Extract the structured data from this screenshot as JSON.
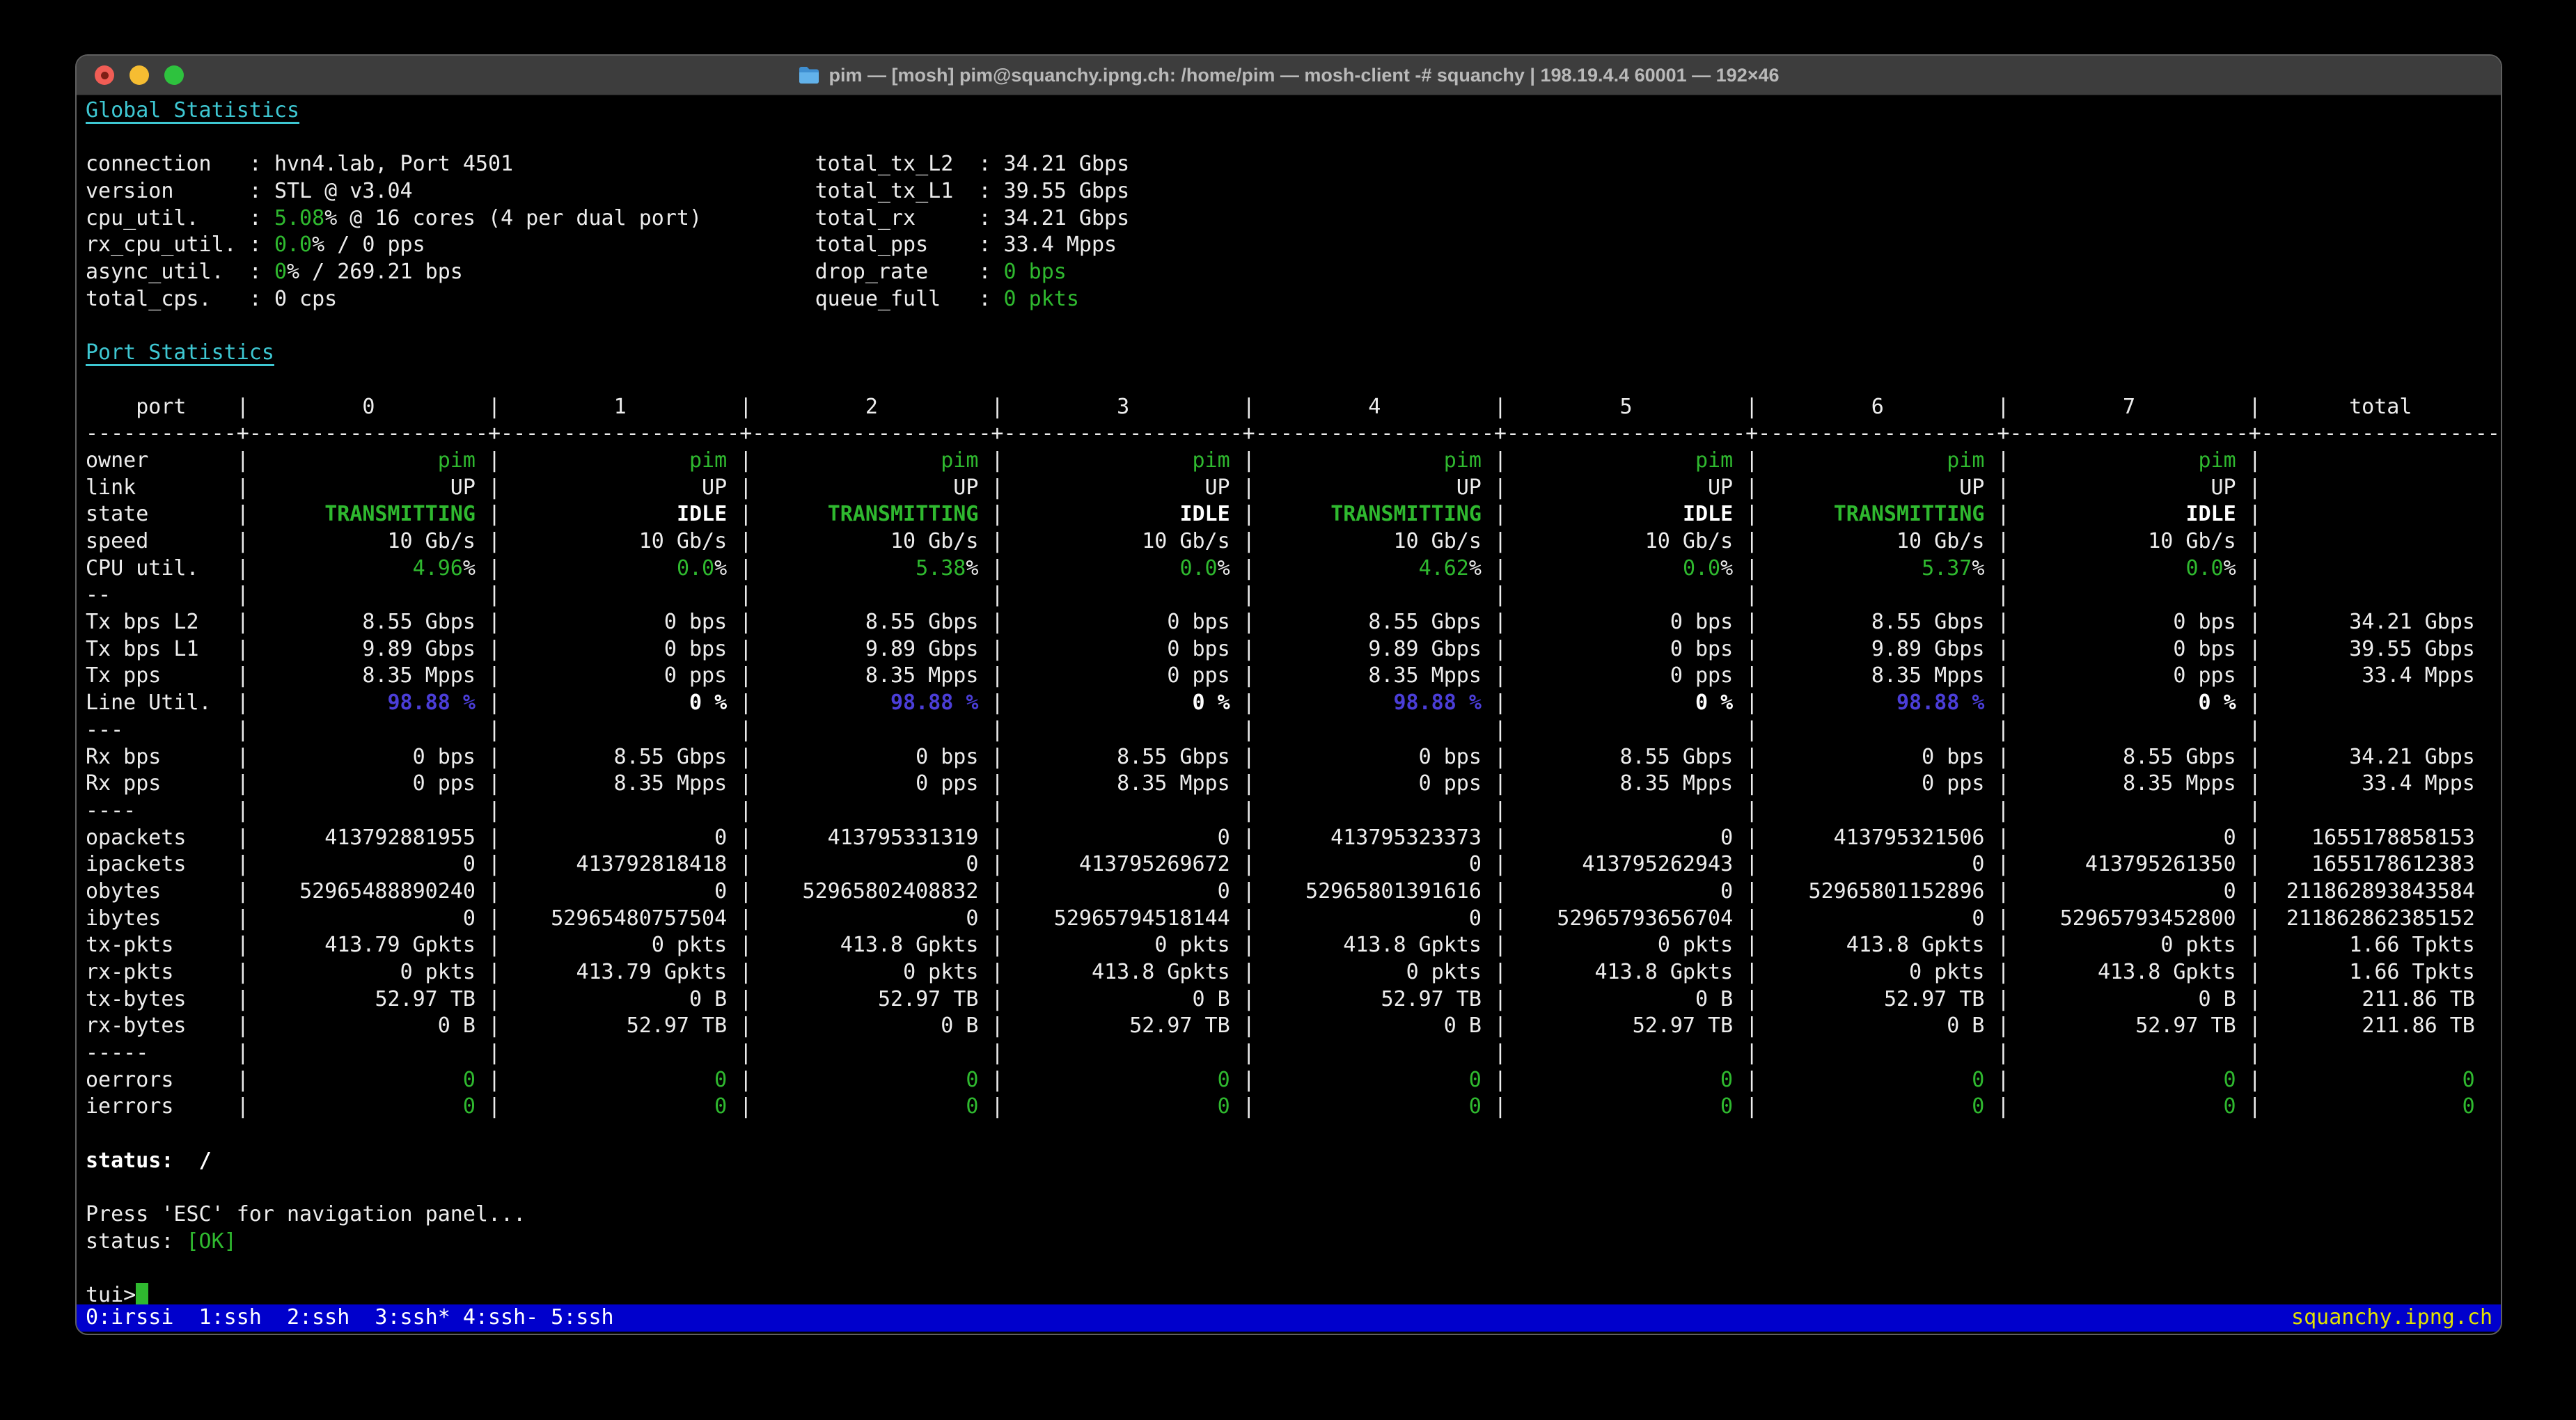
{
  "window": {
    "title": "pim — [mosh] pim@squanchy.ipng.ch: /home/pim — mosh-client -# squanchy | 198.19.4.4 60001 — 192×46"
  },
  "colors": {
    "terminal_bg": "#000000",
    "titlebar_bg": "#3d3d3d",
    "text": "#ededed",
    "green": "#2fb92f",
    "cyan": "#3ec7d2",
    "blue_bold": "#4b3ed8",
    "statusbar_bg": "#0000cc",
    "statusbar_host": "#e2e200",
    "traffic_close": "#f15d55",
    "traffic_min": "#f6bd32",
    "traffic_max": "#2ec23e"
  },
  "global_stats": {
    "heading": "Global Statistics",
    "right_col": 58,
    "lines": [
      {
        "left_label": "connection",
        "left": [
          {
            "t": "hvn4.lab, Port 4501"
          }
        ],
        "right_label": "total_tx_L2",
        "right": [
          {
            "t": "34.21 Gbps"
          }
        ]
      },
      {
        "left_label": "version",
        "left": [
          {
            "t": "STL @ v3.04"
          }
        ],
        "right_label": "total_tx_L1",
        "right": [
          {
            "t": "39.55 Gbps"
          }
        ]
      },
      {
        "left_label": "cpu_util.",
        "left": [
          {
            "t": "5.08",
            "c": "g"
          },
          {
            "t": "% @ 16 cores (4 per dual port)"
          }
        ],
        "right_label": "total_rx",
        "right": [
          {
            "t": "34.21 Gbps"
          }
        ]
      },
      {
        "left_label": "rx_cpu_util.",
        "left": [
          {
            "t": "0.0",
            "c": "g"
          },
          {
            "t": "% / 0 pps"
          }
        ],
        "right_label": "total_pps",
        "right": [
          {
            "t": "33.4 Mpps"
          }
        ]
      },
      {
        "left_label": "async_util.",
        "left": [
          {
            "t": "0",
            "c": "g"
          },
          {
            "t": "% / 269.21 bps"
          }
        ],
        "right_label": "drop_rate",
        "right": [
          {
            "t": "0 bps",
            "c": "g"
          }
        ]
      },
      {
        "left_label": "total_cps.",
        "left": [
          {
            "t": "0 cps"
          }
        ],
        "right_label": "queue_full",
        "right": [
          {
            "t": "0 pkts",
            "c": "g"
          }
        ]
      }
    ]
  },
  "port_stats": {
    "heading": "Port Statistics",
    "header": {
      "label": "port",
      "ports": [
        "0",
        "1",
        "2",
        "3",
        "4",
        "5",
        "6",
        "7"
      ],
      "total": "total"
    },
    "rows": [
      {
        "label": "owner",
        "cls": "g",
        "cells": [
          "pim",
          "pim",
          "pim",
          "pim",
          "pim",
          "pim",
          "pim",
          "pim"
        ],
        "total": ""
      },
      {
        "label": "link",
        "cls": "w",
        "cells": [
          "UP",
          "UP",
          "UP",
          "UP",
          "UP",
          "UP",
          "UP",
          "UP"
        ],
        "total": ""
      },
      {
        "label": "state",
        "cells": [
          {
            "t": "TRANSMITTING",
            "c": "gb"
          },
          {
            "t": "IDLE",
            "c": "wb"
          },
          {
            "t": "TRANSMITTING",
            "c": "gb"
          },
          {
            "t": "IDLE",
            "c": "wb"
          },
          {
            "t": "TRANSMITTING",
            "c": "gb"
          },
          {
            "t": "IDLE",
            "c": "wb"
          },
          {
            "t": "TRANSMITTING",
            "c": "gb"
          },
          {
            "t": "IDLE",
            "c": "wb"
          }
        ],
        "total": ""
      },
      {
        "label": "speed",
        "cls": "w",
        "cells": [
          "10 Gb/s",
          "10 Gb/s",
          "10 Gb/s",
          "10 Gb/s",
          "10 Gb/s",
          "10 Gb/s",
          "10 Gb/s",
          "10 Gb/s"
        ],
        "total": ""
      },
      {
        "label": "CPU util.",
        "cells": [
          [
            {
              "t": "4.96",
              "c": "g"
            },
            {
              "t": "%",
              "c": "w"
            }
          ],
          [
            {
              "t": "0.0",
              "c": "g"
            },
            {
              "t": "%",
              "c": "w"
            }
          ],
          [
            {
              "t": "5.38",
              "c": "g"
            },
            {
              "t": "%",
              "c": "w"
            }
          ],
          [
            {
              "t": "0.0",
              "c": "g"
            },
            {
              "t": "%",
              "c": "w"
            }
          ],
          [
            {
              "t": "4.62",
              "c": "g"
            },
            {
              "t": "%",
              "c": "w"
            }
          ],
          [
            {
              "t": "0.0",
              "c": "g"
            },
            {
              "t": "%",
              "c": "w"
            }
          ],
          [
            {
              "t": "5.37",
              "c": "g"
            },
            {
              "t": "%",
              "c": "w"
            }
          ],
          [
            {
              "t": "0.0",
              "c": "g"
            },
            {
              "t": "%",
              "c": "w"
            }
          ]
        ],
        "total": ""
      },
      {
        "label": "--",
        "cells": [
          "",
          "",
          "",
          "",
          "",
          "",
          "",
          ""
        ],
        "total": ""
      },
      {
        "label": "Tx bps L2",
        "cls": "w",
        "cells": [
          "8.55 Gbps",
          "0 bps",
          "8.55 Gbps",
          "0 bps",
          "8.55 Gbps",
          "0 bps",
          "8.55 Gbps",
          "0 bps"
        ],
        "total": "34.21 Gbps"
      },
      {
        "label": "Tx bps L1",
        "cls": "w",
        "cells": [
          "9.89 Gbps",
          "0 bps",
          "9.89 Gbps",
          "0 bps",
          "9.89 Gbps",
          "0 bps",
          "9.89 Gbps",
          "0 bps"
        ],
        "total": "39.55 Gbps"
      },
      {
        "label": "Tx pps",
        "cls": "w",
        "cells": [
          "8.35 Mpps",
          "0 pps",
          "8.35 Mpps",
          "0 pps",
          "8.35 Mpps",
          "0 pps",
          "8.35 Mpps",
          "0 pps"
        ],
        "total": "33.4 Mpps"
      },
      {
        "label": "Line Util.",
        "cells": [
          {
            "t": "98.88 %",
            "c": "bb"
          },
          {
            "t": "0 %",
            "c": "wb"
          },
          {
            "t": "98.88 %",
            "c": "bb"
          },
          {
            "t": "0 %",
            "c": "wb"
          },
          {
            "t": "98.88 %",
            "c": "bb"
          },
          {
            "t": "0 %",
            "c": "wb"
          },
          {
            "t": "98.88 %",
            "c": "bb"
          },
          {
            "t": "0 %",
            "c": "wb"
          }
        ],
        "total": ""
      },
      {
        "label": "---",
        "cells": [
          "",
          "",
          "",
          "",
          "",
          "",
          "",
          ""
        ],
        "total": ""
      },
      {
        "label": "Rx bps",
        "cls": "w",
        "cells": [
          "0 bps",
          "8.55 Gbps",
          "0 bps",
          "8.55 Gbps",
          "0 bps",
          "8.55 Gbps",
          "0 bps",
          "8.55 Gbps"
        ],
        "total": "34.21 Gbps"
      },
      {
        "label": "Rx pps",
        "cls": "w",
        "cells": [
          "0 pps",
          "8.35 Mpps",
          "0 pps",
          "8.35 Mpps",
          "0 pps",
          "8.35 Mpps",
          "0 pps",
          "8.35 Mpps"
        ],
        "total": "33.4 Mpps"
      },
      {
        "label": "----",
        "cells": [
          "",
          "",
          "",
          "",
          "",
          "",
          "",
          ""
        ],
        "total": ""
      },
      {
        "label": "opackets",
        "cls": "w",
        "cells": [
          "413792881955",
          "0",
          "413795331319",
          "0",
          "413795323373",
          "0",
          "413795321506",
          "0"
        ],
        "total": "1655178858153"
      },
      {
        "label": "ipackets",
        "cls": "w",
        "cells": [
          "0",
          "413792818418",
          "0",
          "413795269672",
          "0",
          "413795262943",
          "0",
          "413795261350"
        ],
        "total": "1655178612383"
      },
      {
        "label": "obytes",
        "cls": "w",
        "cells": [
          "52965488890240",
          "0",
          "52965802408832",
          "0",
          "52965801391616",
          "0",
          "52965801152896",
          "0"
        ],
        "total": "211862893843584"
      },
      {
        "label": "ibytes",
        "cls": "w",
        "cells": [
          "0",
          "52965480757504",
          "0",
          "52965794518144",
          "0",
          "52965793656704",
          "0",
          "52965793452800"
        ],
        "total": "211862862385152"
      },
      {
        "label": "tx-pkts",
        "cls": "w",
        "cells": [
          "413.79 Gpkts",
          "0 pkts",
          "413.8 Gpkts",
          "0 pkts",
          "413.8 Gpkts",
          "0 pkts",
          "413.8 Gpkts",
          "0 pkts"
        ],
        "total": "1.66 Tpkts"
      },
      {
        "label": "rx-pkts",
        "cls": "w",
        "cells": [
          "0 pkts",
          "413.79 Gpkts",
          "0 pkts",
          "413.8 Gpkts",
          "0 pkts",
          "413.8 Gpkts",
          "0 pkts",
          "413.8 Gpkts"
        ],
        "total": "1.66 Tpkts"
      },
      {
        "label": "tx-bytes",
        "cls": "w",
        "cells": [
          "52.97 TB",
          "0 B",
          "52.97 TB",
          "0 B",
          "52.97 TB",
          "0 B",
          "52.97 TB",
          "0 B"
        ],
        "total": "211.86 TB"
      },
      {
        "label": "rx-bytes",
        "cls": "w",
        "cells": [
          "0 B",
          "52.97 TB",
          "0 B",
          "52.97 TB",
          "0 B",
          "52.97 TB",
          "0 B",
          "52.97 TB"
        ],
        "total": "211.86 TB"
      },
      {
        "label": "-----",
        "cells": [
          "",
          "",
          "",
          "",
          "",
          "",
          "",
          ""
        ],
        "total": ""
      },
      {
        "label": "oerrors",
        "cls": "g",
        "cells": [
          "0",
          "0",
          "0",
          "0",
          "0",
          "0",
          "0",
          "0"
        ],
        "total": {
          "t": "0",
          "c": "g"
        }
      },
      {
        "label": "ierrors",
        "cls": "g",
        "cells": [
          "0",
          "0",
          "0",
          "0",
          "0",
          "0",
          "0",
          "0"
        ],
        "total": {
          "t": "0",
          "c": "g"
        }
      }
    ]
  },
  "footer": {
    "status_line": [
      {
        "t": "status:",
        "c": "wb"
      },
      {
        "t": "  ",
        "c": "w"
      },
      {
        "t": "/",
        "c": "wb"
      }
    ],
    "esc_hint": "Press 'ESC' for navigation panel...",
    "ok_line": [
      {
        "t": "status: ",
        "c": "w"
      },
      {
        "t": "[OK]",
        "c": "g"
      }
    ],
    "prompt": "tui>",
    "screen_bar": {
      "windows": "0:irssi  1:ssh  2:ssh  3:ssh* 4:ssh- 5:ssh",
      "host": "squanchy.ipng.ch"
    }
  }
}
